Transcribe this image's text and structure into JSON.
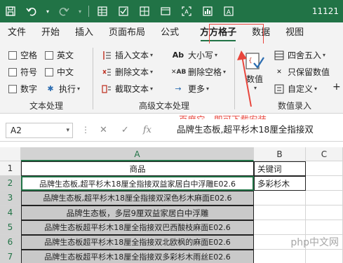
{
  "titlebar": {
    "icons": [
      "save-icon",
      "undo-icon",
      "redo-icon",
      "table-icon",
      "checkbox-icon",
      "grid-icon",
      "window-icon",
      "ocr-icon",
      "chart-icon",
      "text-icon"
    ],
    "text": "11121"
  },
  "tabs": [
    {
      "label": "文件"
    },
    {
      "label": "开始"
    },
    {
      "label": "插入"
    },
    {
      "label": "页面布局"
    },
    {
      "label": "公式"
    },
    {
      "label": "方方格子",
      "active": true
    },
    {
      "label": "数据"
    },
    {
      "label": "视图"
    }
  ],
  "ribbon": {
    "text_group": {
      "checkboxes": [
        "空格",
        "英文",
        "符号",
        "中文",
        "数字"
      ],
      "execute": "执行",
      "label": "文本处理"
    },
    "advanced_group": {
      "items": [
        "插入文本",
        "删除文本",
        "截取文本",
        "大小写",
        "删除空格",
        "更多"
      ],
      "label": "高级文本处理"
    },
    "number_group": {
      "big_button": "数值",
      "items": [
        "四舍五入",
        "只保留数值",
        "自定义"
      ],
      "label": "数值录入"
    }
  },
  "annotation": "百度它，即可下载安装",
  "formula_bar": {
    "name_box": "A2",
    "formula": "品牌生态板,超平杉木18厘全指接双"
  },
  "grid": {
    "columns": [
      "A",
      "B",
      "C"
    ],
    "rows": [
      {
        "num": "1",
        "a": "商品",
        "b": "关键词"
      },
      {
        "num": "2",
        "a": "品牌生态板,超平杉木18厘全指接双益家居白中浮雕E02.6",
        "b": "多彩杉木"
      },
      {
        "num": "3",
        "a": "品牌生态板,超平杉木18厘全指接双深色杉木麻面E02.6",
        "b": ""
      },
      {
        "num": "4",
        "a": "品牌生态板，多层9厘双益家居白中浮雕",
        "b": ""
      },
      {
        "num": "5",
        "a": "品牌生态板超平杉木18厘全指接双巴西酸枝麻面E02.6",
        "b": ""
      },
      {
        "num": "6",
        "a": "品牌生态板超平杉木18厘全指接双北欧枫的麻面E02.6",
        "b": ""
      },
      {
        "num": "7",
        "a": "品牌生态板超平杉木18厘全指接双多彩杉木雨丝E02.6",
        "b": ""
      }
    ]
  },
  "watermark": "php中文网"
}
